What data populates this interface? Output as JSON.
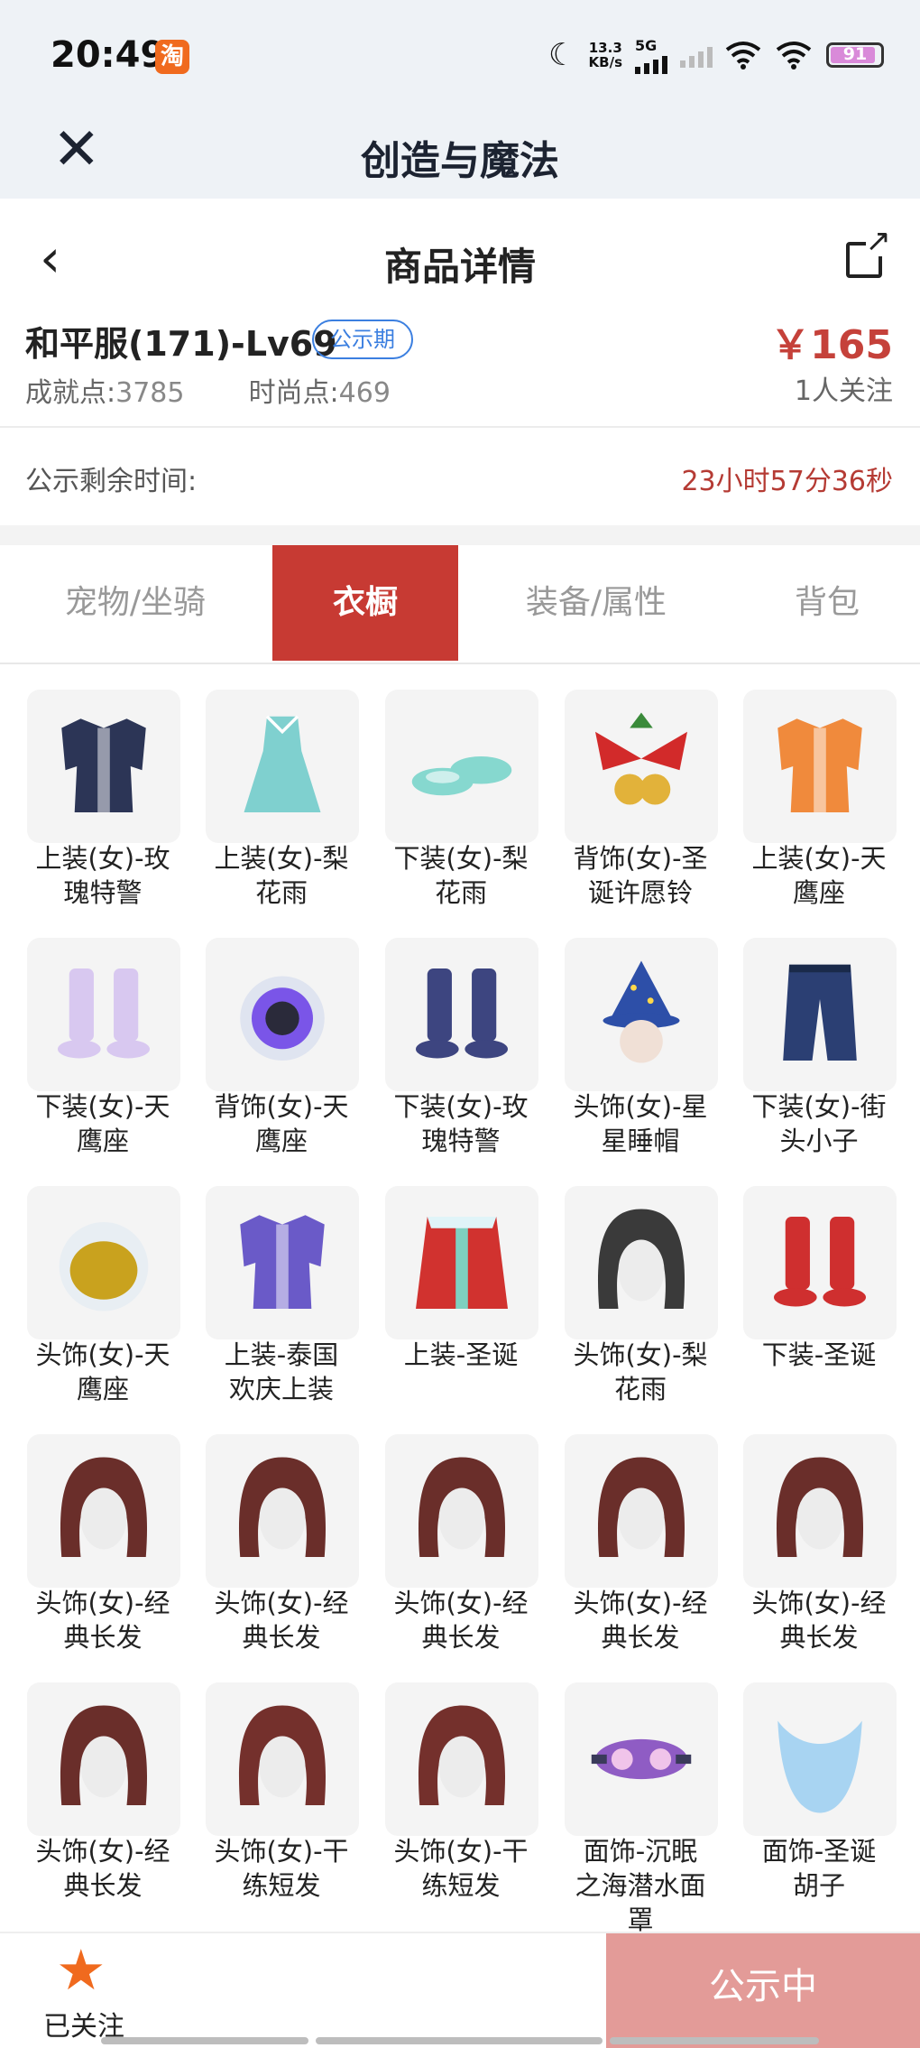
{
  "status_bar": {
    "time": "20:49",
    "app_icon_glyph": "淘",
    "speed_value": "13.3",
    "speed_unit": "KB/s",
    "network": "5G",
    "battery": "91"
  },
  "top_bar": {
    "close_icon": "close-icon",
    "title": "创造与魔法"
  },
  "nav": {
    "back_icon": "chevron-left-icon",
    "title": "商品详情",
    "share_icon": "share-icon"
  },
  "product": {
    "name": "和平服(171)-Lv69",
    "badge": "公示期",
    "achievement_label": "成就点:",
    "achievement_value": "3785",
    "fashion_label": "时尚点:",
    "fashion_value": "469",
    "price": "￥165",
    "followers": "1人关注"
  },
  "timer": {
    "label": "公示剩余时间:",
    "value": "23小时57分36秒"
  },
  "tabs": [
    {
      "label": "宠物/坐骑"
    },
    {
      "label": "衣橱"
    },
    {
      "label": "装备/属性"
    },
    {
      "label": "背包"
    }
  ],
  "active_tab_index": 1,
  "colors": {
    "accent_red": "#c73a33",
    "price_red": "#c5413a",
    "badge_blue": "#3b7fe0",
    "star_orange": "#f06a1e",
    "disabled_button": "#e39b98"
  },
  "items": [
    {
      "line1": "上装(女)-玫",
      "line2": "瑰特警",
      "icon": "outfit-top-icon",
      "color": "#2c3556"
    },
    {
      "line1": "上装(女)-梨",
      "line2": "花雨",
      "icon": "dress-icon",
      "color": "#7fd0cf"
    },
    {
      "line1": "下装(女)-梨",
      "line2": "花雨",
      "icon": "shoes-icon",
      "color": "#86d8cf"
    },
    {
      "line1": "背饰(女)-圣",
      "line2": "诞许愿铃",
      "icon": "bell-bow-icon",
      "color": "#d22a2a"
    },
    {
      "line1": "上装(女)-天",
      "line2": "鹰座",
      "icon": "outfit-top-icon",
      "color": "#f08a3c"
    },
    {
      "line1": "下装(女)-天",
      "line2": "鹰座",
      "icon": "boots-icon",
      "color": "#d8c8f0"
    },
    {
      "line1": "背饰(女)-天",
      "line2": "鹰座",
      "icon": "backpack-icon",
      "color": "#7a55e8"
    },
    {
      "line1": "下装(女)-玫",
      "line2": "瑰特警",
      "icon": "boots-icon",
      "color": "#3d4580"
    },
    {
      "line1": "头饰(女)-星",
      "line2": "星睡帽",
      "icon": "wizard-hat-icon",
      "color": "#2d4fa8"
    },
    {
      "line1": "下装(女)-街",
      "line2": "头小子",
      "icon": "pants-icon",
      "color": "#2b3f73"
    },
    {
      "line1": "头饰(女)-天",
      "line2": "鹰座",
      "icon": "helmet-icon",
      "color": "#c9a21e"
    },
    {
      "line1": "上装-泰国",
      "line2": "欢庆上装",
      "icon": "outfit-top-icon",
      "color": "#6a5ac8"
    },
    {
      "line1": "上装-圣诞",
      "line2": "",
      "icon": "coat-icon",
      "color": "#d1322f"
    },
    {
      "line1": "头饰(女)-梨",
      "line2": "花雨",
      "icon": "hair-icon",
      "color": "#3a3a3a"
    },
    {
      "line1": "下装-圣诞",
      "line2": "",
      "icon": "boots-icon",
      "color": "#cf2f2f"
    },
    {
      "line1": "头饰(女)-经",
      "line2": "典长发",
      "icon": "hair-icon",
      "color": "#6a2e2a"
    },
    {
      "line1": "头饰(女)-经",
      "line2": "典长发",
      "icon": "hair-icon",
      "color": "#6a2e2a"
    },
    {
      "line1": "头饰(女)-经",
      "line2": "典长发",
      "icon": "hair-icon",
      "color": "#6a2e2a"
    },
    {
      "line1": "头饰(女)-经",
      "line2": "典长发",
      "icon": "hair-icon",
      "color": "#6a2e2a"
    },
    {
      "line1": "头饰(女)-经",
      "line2": "典长发",
      "icon": "hair-icon",
      "color": "#6a2e2a"
    },
    {
      "line1": "头饰(女)-经",
      "line2": "典长发",
      "icon": "hair-icon",
      "color": "#6a2e2a"
    },
    {
      "line1": "头饰(女)-干",
      "line2": "练短发",
      "icon": "hair-icon",
      "color": "#74302c"
    },
    {
      "line1": "头饰(女)-干",
      "line2": "练短发",
      "icon": "hair-icon",
      "color": "#74302c"
    },
    {
      "line1": "面饰-沉眠",
      "line2": "之海潜水面",
      "line3": "罩",
      "icon": "diving-mask-icon",
      "color": "#8f5cc4"
    },
    {
      "line1": "面饰-圣诞",
      "line2": "胡子",
      "icon": "beard-icon",
      "color": "#a8d4f2"
    }
  ],
  "bottom": {
    "follow_icon": "star-icon",
    "follow_label": "已关注",
    "status_button": "公示中"
  }
}
